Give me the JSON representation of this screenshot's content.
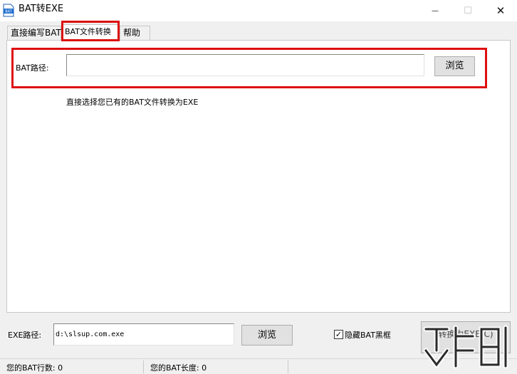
{
  "window": {
    "title": "BAT转EXE",
    "icon": "bat-file-icon",
    "minimize_glyph": "—",
    "maximize_glyph": "☐",
    "close_glyph": "✕"
  },
  "tabs": [
    {
      "label": "直接编写BAT",
      "active": false
    },
    {
      "label": "BAT文件转换",
      "active": true
    },
    {
      "label": "帮助",
      "active": false
    }
  ],
  "bat_panel": {
    "path_label": "BAT路径:",
    "path_value": "",
    "browse_label": "浏览",
    "hint": "直接选择您已有的BAT文件转换为EXE"
  },
  "exe_section": {
    "path_label": "EXE路径:",
    "path_value": "d:\\slsup.com.exe",
    "browse_label": "浏览",
    "hide_checkbox_mark": "✓",
    "hide_checkbox_label": "隐藏BAT黑框",
    "hide_checkbox_checked": true,
    "convert_label": "转换为EXE(C)"
  },
  "status_bar": {
    "lines_text": "您的BAT行数: 0",
    "length_text": "您的BAT长度: 0"
  },
  "highlight_color": "#dd1010"
}
